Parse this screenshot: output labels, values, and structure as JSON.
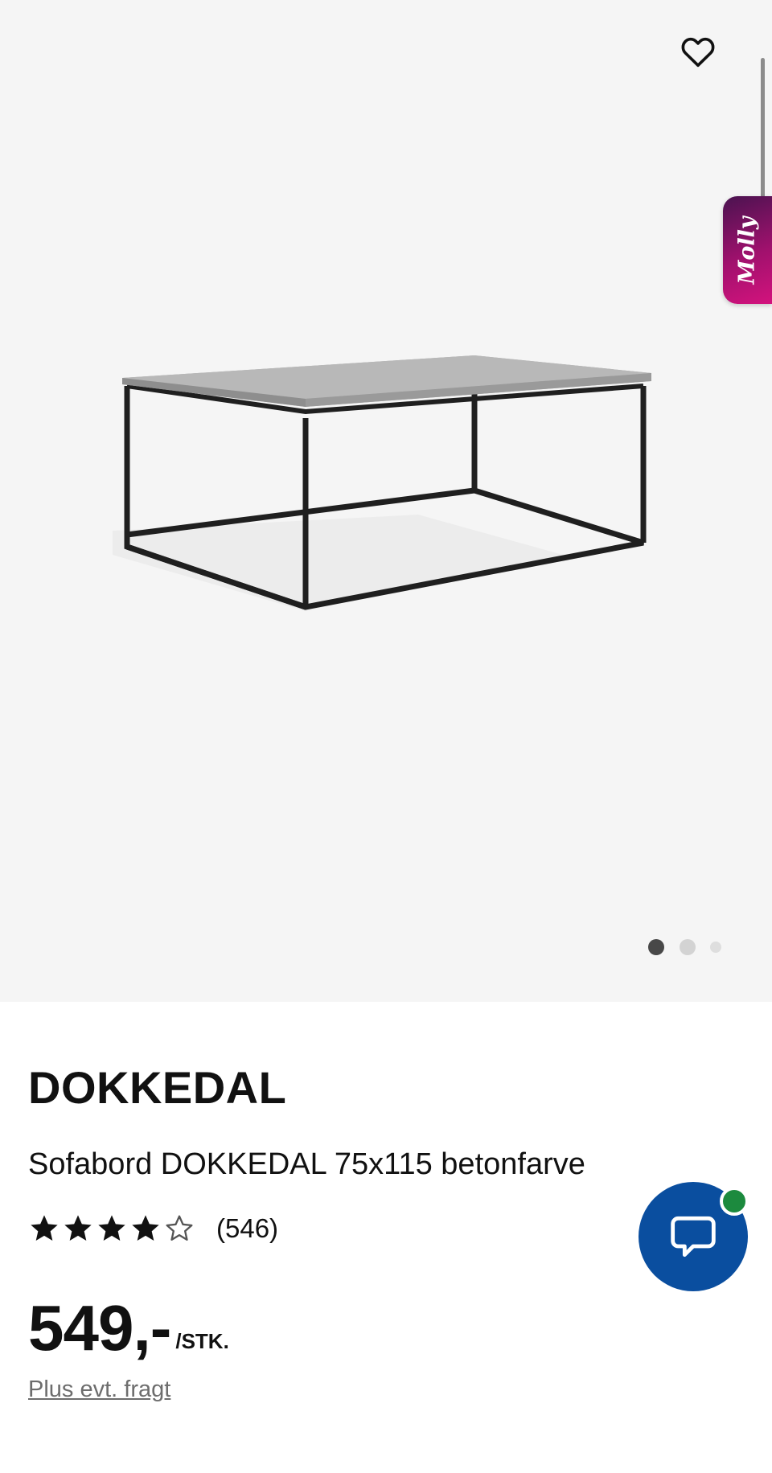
{
  "gallery": {
    "favorite_icon": "heart-outline-icon",
    "chat_tab_label": "Molly",
    "image_count": 3,
    "active_image_index": 0,
    "colors": {
      "background": "#f5f5f5",
      "molly_gradient_start": "#4a1350",
      "molly_gradient_end": "#d3127d",
      "dot_active": "#484848",
      "dot_inactive": "#d3d3d3"
    }
  },
  "product": {
    "name": "DOKKEDAL",
    "description": "Sofabord DOKKEDAL 75x115 betonfarve",
    "rating": {
      "value": 4,
      "max": 5,
      "review_count": "(546)"
    },
    "price": {
      "value": "549,-",
      "unit": "/STK."
    },
    "shipping_note": "Plus evt. fragt"
  },
  "chat": {
    "icon": "speech-bubble-icon",
    "status": "online",
    "colors": {
      "button": "#0a4e9f",
      "status": "#1c8a3e"
    }
  }
}
